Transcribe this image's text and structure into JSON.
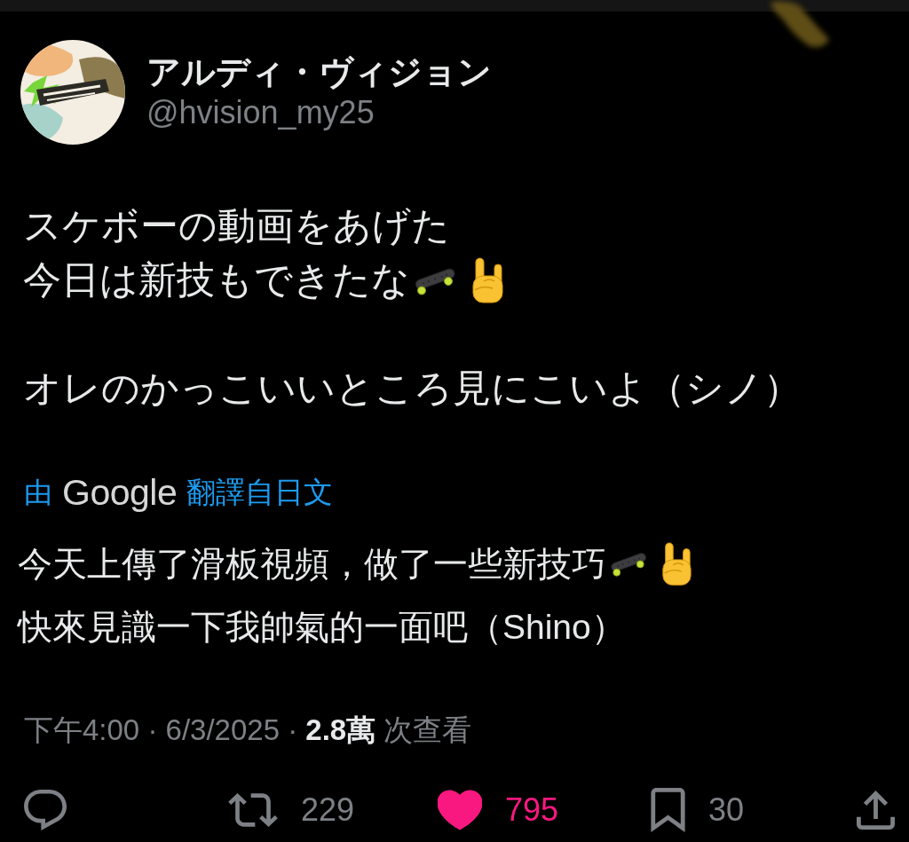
{
  "author": {
    "name": "アルディ・ヴィジョン",
    "handle": "@hvision_my25"
  },
  "body": [
    {
      "lines": [
        {
          "segments": [
            {
              "kind": "text",
              "text": "スケボーの動画をあげた"
            }
          ]
        },
        {
          "segments": [
            {
              "kind": "text",
              "text": "今日は新技もできたな"
            },
            {
              "kind": "skateboard"
            },
            {
              "kind": "horns"
            }
          ]
        }
      ]
    },
    {
      "lines": [
        {
          "segments": [
            {
              "kind": "text",
              "text": "オレのかっこいいところ見にこいよ（シノ）"
            }
          ]
        }
      ]
    }
  ],
  "translation": {
    "prefix": "由",
    "provider": "Google",
    "label": "翻譯自日文",
    "lines": [
      {
        "segments": [
          {
            "kind": "text",
            "text": "今天上傳了滑板視頻，做了一些新技巧"
          },
          {
            "kind": "skateboard"
          },
          {
            "kind": "horns"
          }
        ]
      },
      {
        "segments": [
          {
            "kind": "text",
            "text": "快來見識一下我帥氣的一面吧（Shino）"
          }
        ]
      }
    ]
  },
  "meta": "下午4:00 · 6/3/2025 · **2.8萬** 次查看",
  "actions": [
    {
      "kind": "reply",
      "active": false
    },
    {
      "kind": "repost",
      "count": "229",
      "active": false
    },
    {
      "kind": "like",
      "count": "795",
      "active": true
    },
    {
      "kind": "bookmark",
      "count": "30",
      "active": false
    },
    {
      "kind": "share",
      "active": false
    }
  ]
}
